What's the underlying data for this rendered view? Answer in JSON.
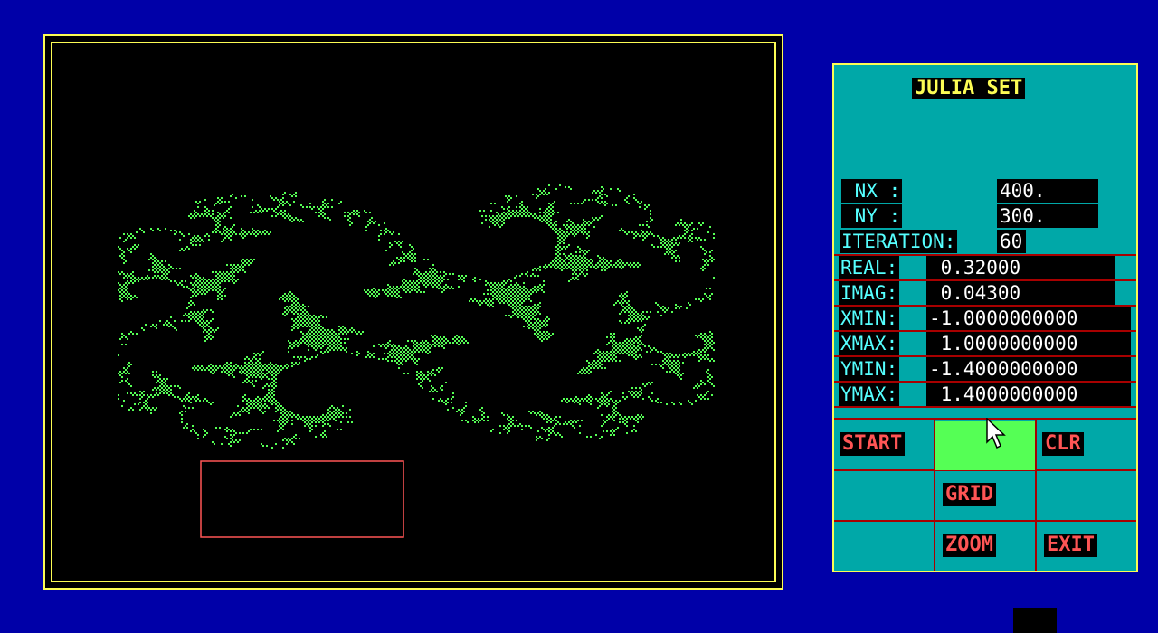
{
  "panel": {
    "title": "JULIA SET",
    "params": [
      {
        "label": " NX :",
        "value": "400."
      },
      {
        "label": " NY :",
        "value": "300."
      },
      {
        "label": "ITERATION:",
        "value": "60"
      },
      {
        "label": "REAL:",
        "value": " 0.32000"
      },
      {
        "label": "IMAG:",
        "value": " 0.04300"
      },
      {
        "label": "XMIN:",
        "value": "-1.0000000000"
      },
      {
        "label": "XMAX:",
        "value": " 1.0000000000"
      },
      {
        "label": "YMIN:",
        "value": "-1.4000000000"
      },
      {
        "label": "YMAX:",
        "value": " 1.4000000000"
      }
    ],
    "buttons": {
      "start": "START",
      "clr": "CLR",
      "grid": "GRID",
      "zoom": "ZOOM",
      "exit": "EXIT"
    }
  },
  "colors": {
    "background": "#0000a8",
    "frame": "#fcfc54",
    "fractal": "#55ff55",
    "panel": "#00a8a8",
    "button_text": "#ff5555",
    "zoom_box": "#ff5555"
  },
  "fractal": {
    "type": "julia",
    "c_real": 0.32,
    "c_imag": 0.043,
    "xmin": -1.0,
    "xmax": 1.0,
    "ymin": -1.4,
    "ymax": 1.4,
    "iterations": 60
  }
}
